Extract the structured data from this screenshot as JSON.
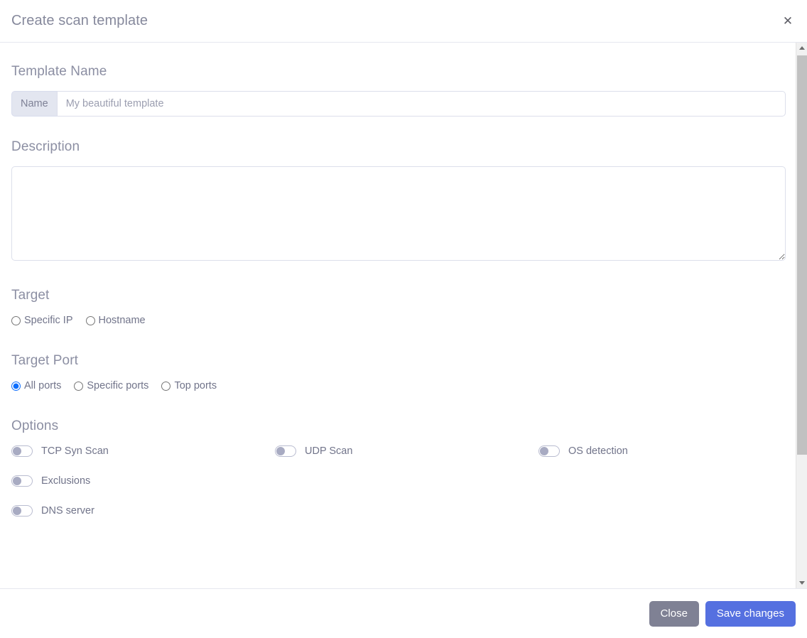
{
  "header": {
    "title": "Create scan template",
    "close_icon": "close-icon",
    "close_glyph": "✕"
  },
  "sections": {
    "template_name": {
      "label": "Template Name",
      "prepend_label": "Name",
      "value": "",
      "placeholder": "My beautiful template"
    },
    "description": {
      "label": "Description",
      "value": "",
      "placeholder": ""
    },
    "target": {
      "label": "Target",
      "options": [
        {
          "label": "Specific IP",
          "checked": false
        },
        {
          "label": "Hostname",
          "checked": false
        }
      ]
    },
    "target_port": {
      "label": "Target Port",
      "options": [
        {
          "label": "All ports",
          "checked": true
        },
        {
          "label": "Specific ports",
          "checked": false
        },
        {
          "label": "Top ports",
          "checked": false
        }
      ]
    },
    "options": {
      "label": "Options",
      "toggles": [
        {
          "label": "TCP Syn Scan",
          "enabled": false
        },
        {
          "label": "UDP Scan",
          "enabled": false
        },
        {
          "label": "OS detection",
          "enabled": false
        },
        {
          "label": "Exclusions",
          "enabled": false
        },
        {
          "label": "DNS server",
          "enabled": false
        }
      ]
    }
  },
  "footer": {
    "close_label": "Close",
    "save_label": "Save changes"
  },
  "colors": {
    "accent_blue": "#5570e0",
    "radio_blue": "#0d6efd",
    "secondary_gray": "#7f8194",
    "heading_gray": "#8c8fa3",
    "prepend_bg": "#e3e6f0"
  }
}
